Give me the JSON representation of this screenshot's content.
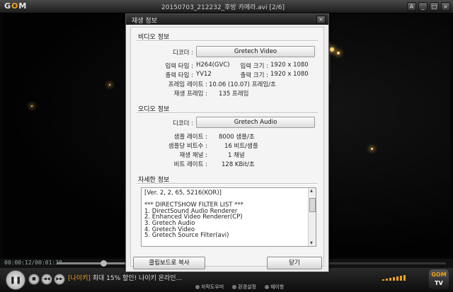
{
  "window": {
    "logo_text": "G",
    "logo_o": "O",
    "logo_m": "M",
    "title": "20150703_212232_후방 카메라.avi  [2/6]",
    "btn_a": "A",
    "btn_min": "_",
    "btn_max": "□",
    "btn_close": "×"
  },
  "timebar": {
    "time": "00:00:12/00:01:30"
  },
  "controls": {
    "pause": "❚❚",
    "ticker_tag": "[나이키]",
    "ticker_text": " 최대 15% 할인! 나이키 온라인...",
    "links": [
      "자막도우미",
      "환경설정",
      "재이항"
    ],
    "gomtv_a": "GOM",
    "gomtv_b": "TV"
  },
  "dialog": {
    "title": "재생 정보",
    "close": "×",
    "video": {
      "heading": "비디오 정보",
      "decoder_label": "디코더 :",
      "decoder": "Gretech Video",
      "input_type_label": "입력 타입 :",
      "input_type": "H264(GVC)",
      "input_size_label": "입력 크기 :",
      "input_size": "1920 x 1080",
      "output_type_label": "출력 타입 :",
      "output_type": "YV12",
      "output_size_label": "출력 크기 :",
      "output_size": "1920 x 1080",
      "framerate_label": "프레임 레이트 :",
      "framerate": "10.06 (10.07) 프레임/초",
      "played_frames_label": "재생 프레임 :",
      "played_frames": "135 프레임"
    },
    "audio": {
      "heading": "오디오 정보",
      "decoder_label": "디코더 :",
      "decoder": "Gretech Audio",
      "sample_rate_label": "샘플 레이트 :",
      "sample_rate": "8000 샘플/초",
      "bits_label": "샘플당 비트수 :",
      "bits": "16 비트/샘플",
      "channels_label": "재생 채널 :",
      "channels": "1 채널",
      "bitrate_label": "비트 레이트 :",
      "bitrate": "128 KBit/초"
    },
    "details": {
      "heading": "자세한 정보",
      "lines": [
        "[Ver. 2, 2, 65, 5216(KOR)]",
        "",
        "*** DIRECTSHOW FILTER LIST ***",
        "1. DirectSound Audio Renderer",
        "2. Enhanced Video Renderer(CP)",
        "3. Gretech Audio",
        "4. Gretech Video",
        "5. Gretech Source Filter(avi)"
      ]
    },
    "copy_button": "클립보드로 복사",
    "close_button": "닫기"
  }
}
